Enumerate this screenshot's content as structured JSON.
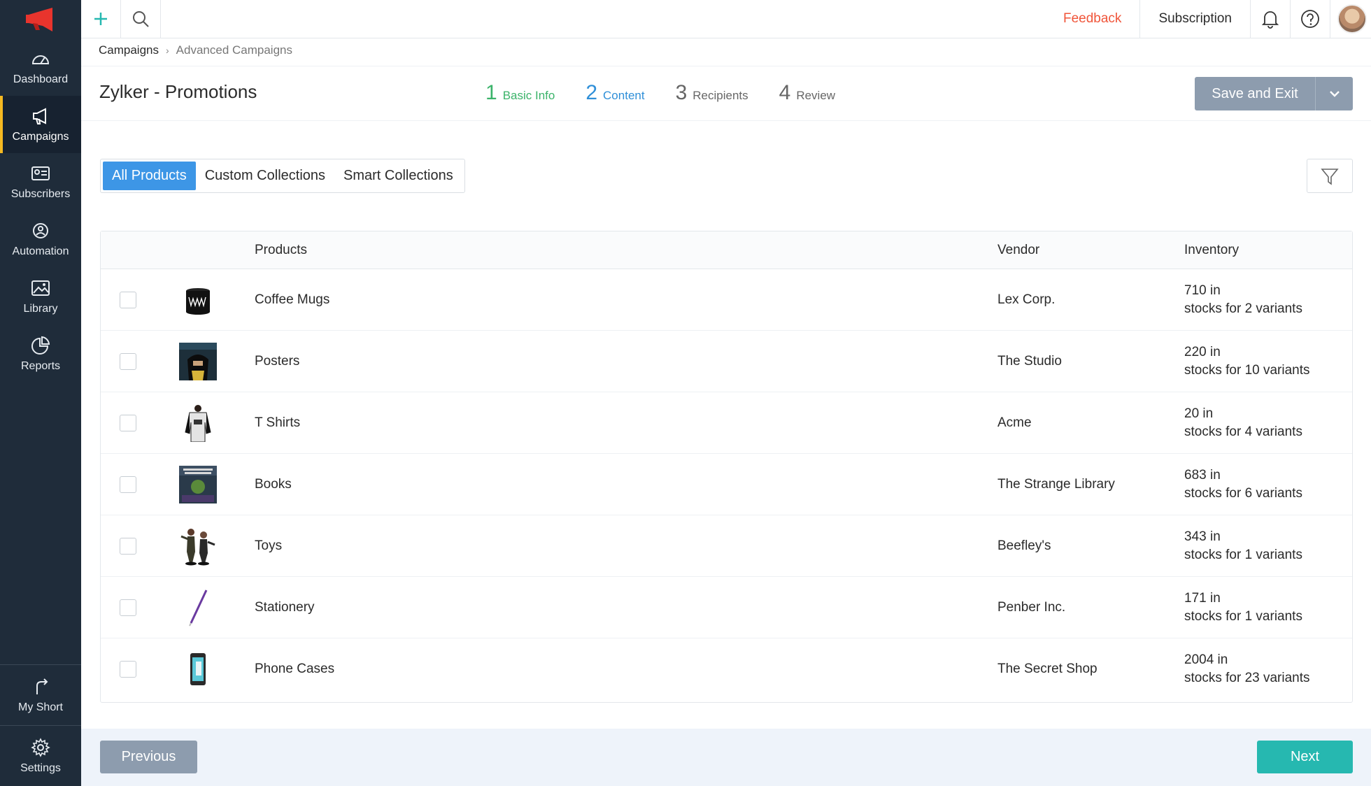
{
  "sidebar": {
    "items": [
      {
        "label": "Dashboard",
        "icon": "dashboard-icon"
      },
      {
        "label": "Campaigns",
        "icon": "megaphone-icon"
      },
      {
        "label": "Subscribers",
        "icon": "contact-card-icon"
      },
      {
        "label": "Automation",
        "icon": "automation-icon"
      },
      {
        "label": "Library",
        "icon": "image-icon"
      },
      {
        "label": "Reports",
        "icon": "pie-chart-icon"
      }
    ],
    "bottom": [
      {
        "label": "My Short",
        "icon": "shortcut-icon"
      },
      {
        "label": "Settings",
        "icon": "gear-icon"
      }
    ]
  },
  "topbar": {
    "feedback": "Feedback",
    "subscription": "Subscription"
  },
  "breadcrumb": {
    "parent": "Campaigns",
    "current": "Advanced Campaigns"
  },
  "header": {
    "title": "Zylker - Promotions",
    "steps": [
      {
        "num": "1",
        "label": "Basic Info"
      },
      {
        "num": "2",
        "label": "Content"
      },
      {
        "num": "3",
        "label": "Recipients"
      },
      {
        "num": "4",
        "label": "Review"
      }
    ],
    "save_label": "Save and Exit"
  },
  "tabs": [
    "All Products",
    "Custom Collections",
    "Smart Collections"
  ],
  "table": {
    "headers": {
      "products": "Products",
      "vendor": "Vendor",
      "inventory": "Inventory"
    },
    "rows": [
      {
        "product": "Coffee Mugs",
        "vendor": "Lex Corp.",
        "inv1": "710 in",
        "inv2": "stocks for 2 variants",
        "thumb": "mug"
      },
      {
        "product": "Posters",
        "vendor": "The Studio",
        "inv1": "220 in",
        "inv2": "stocks for 10 variants",
        "thumb": "poster"
      },
      {
        "product": "T Shirts",
        "vendor": "Acme",
        "inv1": "20 in",
        "inv2": "stocks for 4 variants",
        "thumb": "tshirt"
      },
      {
        "product": "Books",
        "vendor": "The Strange Library",
        "inv1": "683 in",
        "inv2": "stocks for 6 variants",
        "thumb": "book"
      },
      {
        "product": "Toys",
        "vendor": "Beefley's",
        "inv1": "343 in",
        "inv2": "stocks for 1  variants",
        "thumb": "toys"
      },
      {
        "product": "Stationery",
        "vendor": "Penber Inc.",
        "inv1": "171 in",
        "inv2": "stocks for 1  variants",
        "thumb": "pen"
      },
      {
        "product": "Phone Cases",
        "vendor": "The Secret Shop",
        "inv1": "2004 in",
        "inv2": "stocks for 23  variants",
        "thumb": "phonecase"
      }
    ]
  },
  "footer": {
    "previous": "Previous",
    "next": "Next"
  }
}
